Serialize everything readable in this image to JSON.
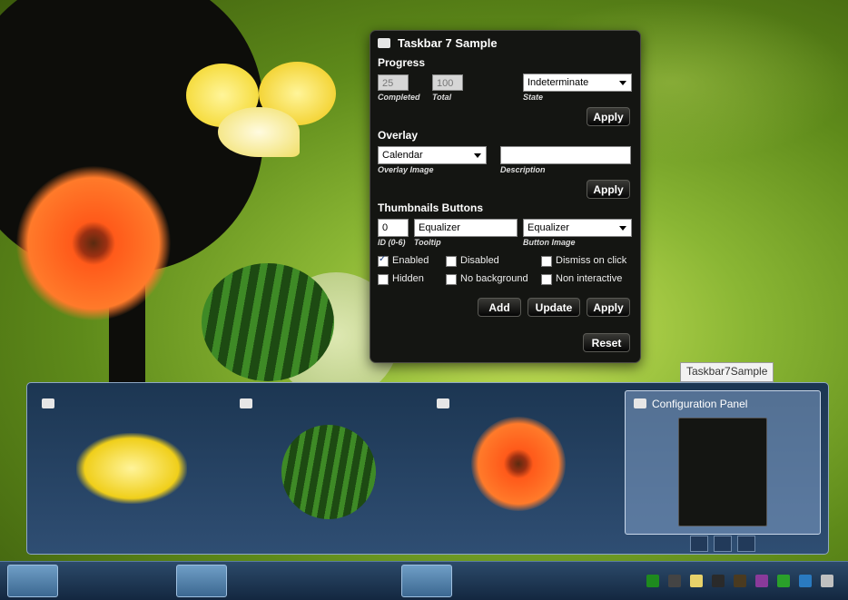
{
  "window": {
    "title": "Taskbar 7 Sample"
  },
  "progress": {
    "section": "Progress",
    "completed_value": "25",
    "completed_label": "Completed",
    "total_value": "100",
    "total_label": "Total",
    "state_value": "Indeterminate",
    "state_label": "State",
    "apply": "Apply"
  },
  "overlay": {
    "section": "Overlay",
    "image_value": "Calendar",
    "image_label": "Overlay Image",
    "description_value": "",
    "description_label": "Description",
    "apply": "Apply"
  },
  "thumbs": {
    "section": "Thumbnails Buttons",
    "id_value": "0",
    "id_label": "ID (0-6)",
    "tooltip_value": "Equalizer",
    "tooltip_label": "Tooltip",
    "image_value": "Equalizer",
    "image_label": "Button Image",
    "checks": {
      "enabled": "Enabled",
      "disabled": "Disabled",
      "dismiss": "Dismiss on click",
      "hidden": "Hidden",
      "nobg": "No background",
      "noninteractive": "Non interactive"
    },
    "add": "Add",
    "update": "Update",
    "apply": "Apply",
    "reset": "Reset"
  },
  "preview": {
    "tooltip": "Taskbar7Sample",
    "config_title": "Configuration Panel"
  },
  "colors": {
    "accent": "#8ab634",
    "window_bg": "#141512",
    "preview_bg": "#2f4e73"
  }
}
